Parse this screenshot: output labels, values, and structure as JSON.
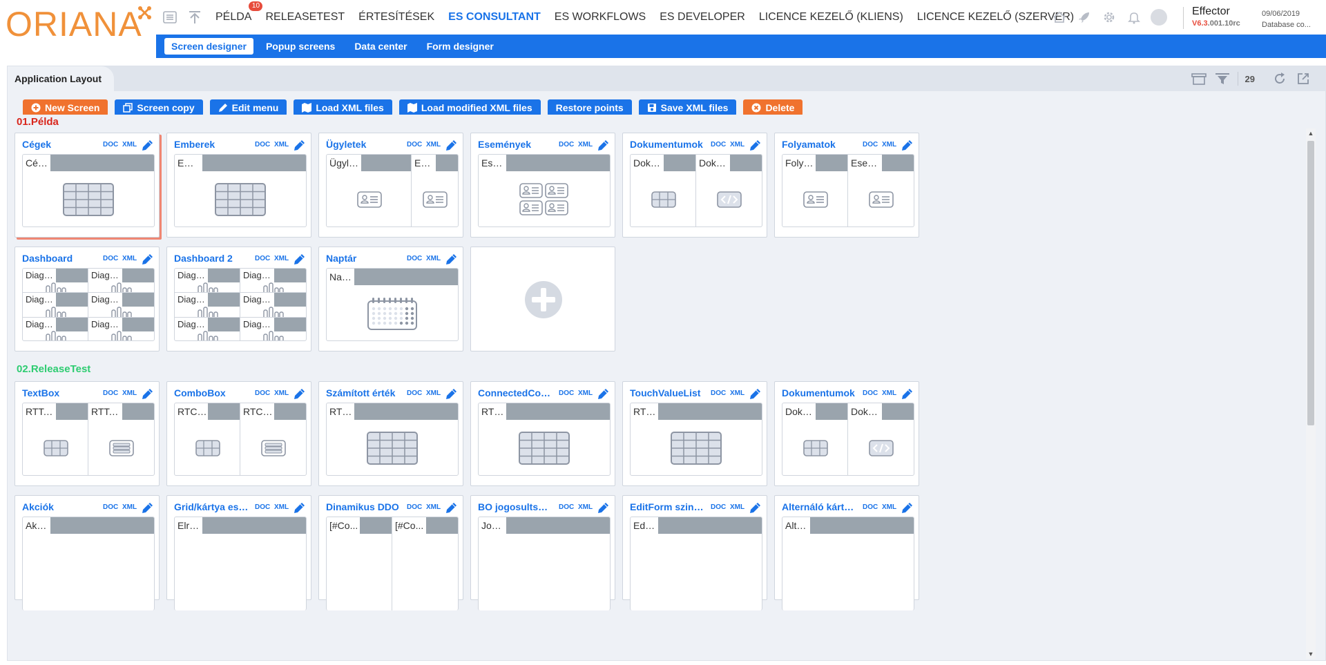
{
  "brand": {
    "logo_text": "ORIANA"
  },
  "nav": {
    "items": [
      {
        "label": "PÉLDA",
        "badge": "10"
      },
      {
        "label": "RELEASETEST"
      },
      {
        "label": "ÉRTESÍTÉSEK"
      },
      {
        "label": "ES CONSULTANT"
      },
      {
        "label": "ES WORKFLOWS"
      },
      {
        "label": "ES DEVELOPER"
      },
      {
        "label": "LICENCE KEZELŐ (KLIENS)"
      },
      {
        "label": "LICENCE KEZELŐ (SZERVER)"
      }
    ],
    "active_index": 3
  },
  "user": {
    "name": "Effector",
    "version_prefix": "V6.3",
    "version_suffix": ".001.10rc",
    "date": "09/06/2019",
    "db": "Database co..."
  },
  "subnav": {
    "items": [
      "Screen designer",
      "Popup screens",
      "Data center",
      "Form designer"
    ],
    "active_index": 0
  },
  "panel": {
    "tab_label": "Application Layout",
    "count": "29"
  },
  "toolbar": {
    "new_screen": "New Screen",
    "screen_copy": "Screen copy",
    "edit_menu": "Edit menu",
    "load_xml": "Load XML files",
    "load_modified_xml": "Load modified XML files",
    "restore_points": "Restore points",
    "save_xml": "Save XML files",
    "delete": "Delete"
  },
  "card_labels": {
    "doc": "DOC",
    "xml": "XML"
  },
  "sections": [
    {
      "title": "01.Példa",
      "color": "#d9261c",
      "cards": [
        {
          "title": "Cégek",
          "layout": "single",
          "cells": [
            {
              "label": "Cégek",
              "icon": "grid-large"
            }
          ]
        },
        {
          "title": "Emberek",
          "layout": "single",
          "cells": [
            {
              "label": "Emberek",
              "icon": "grid-large"
            }
          ]
        },
        {
          "title": "Ügyletek",
          "layout": "wide-narrow",
          "cells": [
            {
              "label": "Ügyletek",
              "icon": "contact-card"
            },
            {
              "label": "Ese...",
              "icon": "contact-card"
            }
          ]
        },
        {
          "title": "Események",
          "layout": "single",
          "cells": [
            {
              "label": "Események",
              "icon": "contact-cards"
            }
          ]
        },
        {
          "title": "Dokumentumok",
          "layout": "half",
          "cells": [
            {
              "label": "Doku...",
              "icon": "grid-small"
            },
            {
              "label": "Doku...",
              "icon": "code"
            }
          ]
        },
        {
          "title": "Folyamatok",
          "layout": "half",
          "cells": [
            {
              "label": "Folya...",
              "icon": "contact-card"
            },
            {
              "label": "Esem...",
              "icon": "contact-card"
            }
          ]
        },
        {
          "title": "Dashboard",
          "layout": "grid3x2",
          "cells": [
            {
              "label": "Diagra...",
              "icon": "bars"
            },
            {
              "label": "Diagra...",
              "icon": "bars"
            },
            {
              "label": "Diagra...",
              "icon": "bars"
            },
            {
              "label": "Diagra...",
              "icon": "bars"
            },
            {
              "label": "Diagra...",
              "icon": "bars"
            },
            {
              "label": "Diagra...",
              "icon": "bars"
            }
          ]
        },
        {
          "title": "Dashboard 2",
          "layout": "grid3x2",
          "cells": [
            {
              "label": "Diagra...",
              "icon": "bars"
            },
            {
              "label": "Diagra...",
              "icon": "bars"
            },
            {
              "label": "Diagra...",
              "icon": "bars"
            },
            {
              "label": "Diagra...",
              "icon": "bars"
            },
            {
              "label": "Diagra...",
              "icon": "bars"
            },
            {
              "label": "Diagra...",
              "icon": "bars"
            }
          ]
        },
        {
          "title": "Naptár",
          "layout": "single",
          "cells": [
            {
              "label": "Naptár",
              "icon": "calendar"
            }
          ]
        },
        {
          "add": true
        }
      ]
    },
    {
      "title": "02.ReleaseTest",
      "color": "#2ecc71",
      "cards": [
        {
          "title": "TextBox",
          "layout": "half",
          "cells": [
            {
              "label": "RTTex...",
              "icon": "grid-small"
            },
            {
              "label": "RTTex...",
              "icon": "form-list"
            }
          ]
        },
        {
          "title": "ComboBox",
          "layout": "half",
          "cells": [
            {
              "label": "RTCo...",
              "icon": "grid-small"
            },
            {
              "label": "RTCo...",
              "icon": "form-list"
            }
          ]
        },
        {
          "title": "Számított érték",
          "layout": "single",
          "cells": [
            {
              "label": "RTComputedVal...",
              "icon": "grid-large"
            }
          ]
        },
        {
          "title": "ConnectedControls",
          "layout": "single",
          "cells": [
            {
              "label": "RTConnectedCo...",
              "icon": "grid-large"
            }
          ]
        },
        {
          "title": "TouchValueList",
          "layout": "single",
          "cells": [
            {
              "label": "RTTouchValueLi...",
              "icon": "grid-large"
            }
          ]
        },
        {
          "title": "Dokumentumok",
          "layout": "half",
          "cells": [
            {
              "label": "Doku...",
              "icon": "grid-small"
            },
            {
              "label": "Doku...",
              "icon": "code"
            }
          ]
        },
        {
          "title": "Akciók",
          "layout": "single-cut",
          "cells": [
            {
              "label": "Akciógombok",
              "icon": ""
            }
          ]
        },
        {
          "title": "Grid/kártya eszköztár",
          "layout": "single-cut",
          "cells": [
            {
              "label": "Elrejtett eszközt...",
              "icon": ""
            }
          ]
        },
        {
          "title": "Dinamikus DDO",
          "layout": "half-cut",
          "cells": [
            {
              "label": "[#Co...",
              "icon": ""
            },
            {
              "label": "[#Co...",
              "icon": ""
            }
          ]
        },
        {
          "title": "BO jogosultságok",
          "layout": "single-cut",
          "cells": [
            {
              "label": "Jogosultság tes...",
              "icon": ""
            }
          ]
        },
        {
          "title": "EditForm szintű Rea...",
          "layout": "single-cut",
          "cells": [
            {
              "label": "EditForm szintű ...",
              "icon": ""
            }
          ]
        },
        {
          "title": "Alternáló kártyák",
          "layout": "single-cut",
          "cells": [
            {
              "label": "Alternáló kártyák",
              "icon": ""
            }
          ]
        }
      ]
    }
  ]
}
